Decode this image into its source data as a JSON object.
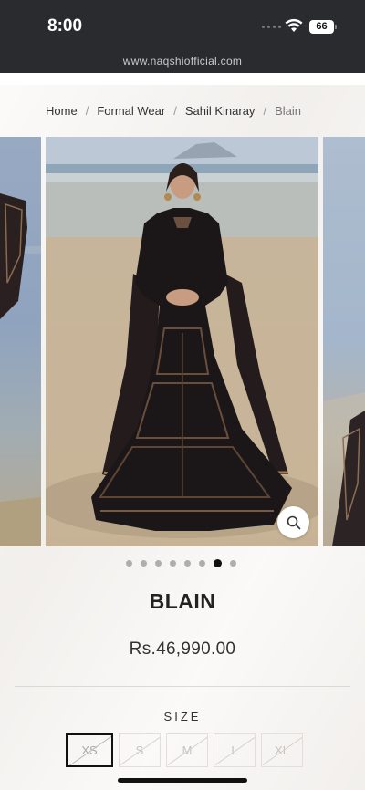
{
  "status_bar": {
    "time": "8:00",
    "battery": "66"
  },
  "browser": {
    "url": "www.naqshiofficial.com"
  },
  "breadcrumb": {
    "items": [
      "Home",
      "Formal Wear",
      "Sahil Kinaray"
    ],
    "current": "Blain",
    "separator": "/"
  },
  "gallery": {
    "slide_count": 8,
    "active_index": 6,
    "zoom_icon": "search-icon"
  },
  "product": {
    "title": "BLAIN",
    "price": "Rs.46,990.00"
  },
  "size": {
    "label": "SIZE",
    "options": [
      {
        "label": "XS",
        "selected": true,
        "available": false
      },
      {
        "label": "S",
        "selected": false,
        "available": false
      },
      {
        "label": "M",
        "selected": false,
        "available": false
      },
      {
        "label": "L",
        "selected": false,
        "available": false
      },
      {
        "label": "XL",
        "selected": false,
        "available": false
      }
    ]
  },
  "colors": {
    "status_bar": "#2a2b2f",
    "background": "#f6f4f1",
    "accent": "#111111",
    "dress": "#1b1718"
  }
}
